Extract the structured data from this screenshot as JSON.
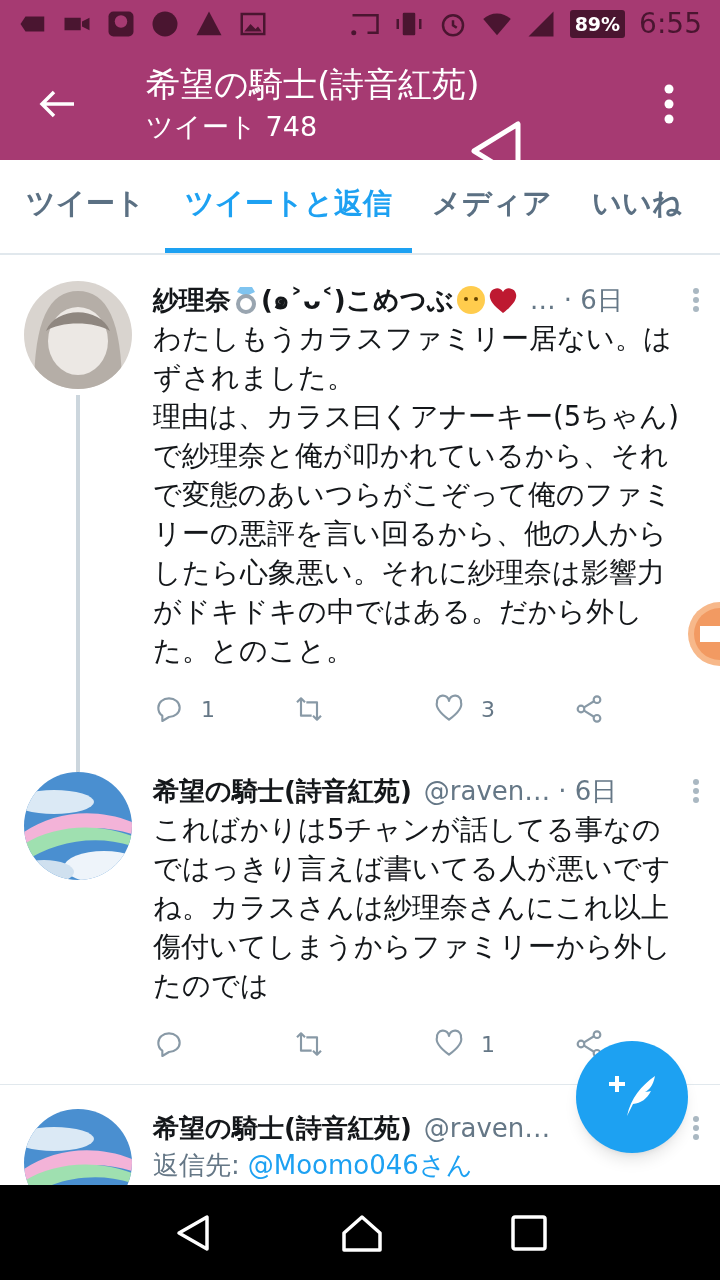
{
  "status_bar": {
    "battery": "89%",
    "time": "6:55"
  },
  "header": {
    "title": "希望の騎士(詩音紅苑)",
    "subtitle": "ツイート 748"
  },
  "tabs": [
    {
      "label": "ツイート",
      "selected": false
    },
    {
      "label": "ツイートと返信",
      "selected": true
    },
    {
      "label": "メディア",
      "selected": false
    },
    {
      "label": "いいね",
      "selected": false
    }
  ],
  "tweets": [
    {
      "name": [
        {
          "kind": "text",
          "text": "紗理奈"
        },
        {
          "kind": "ring"
        },
        {
          "kind": "text",
          "text": "(๑˃ᴗ˂)こめつぶ"
        },
        {
          "kind": "face"
        },
        {
          "kind": "heart"
        }
      ],
      "handle": "…",
      "time": "· 6日",
      "thread": true,
      "text": [
        "わたしもうカラスファミリー居ない。はずされました。",
        "理由は、カラス曰くアナーキー(5ちゃん)で紗理奈と俺が叩かれているから、それで変態のあいつらがこぞって俺のファミリーの悪評を言い回るから、他の人からしたら心象悪い。それに紗理奈は影響力がドキドキの中ではある。だから外した。とのこと。"
      ],
      "replies": "1",
      "likes": "3"
    },
    {
      "name": [
        {
          "kind": "text",
          "text": "希望の騎士(詩音紅苑)"
        }
      ],
      "handle": "@raven…",
      "time": "· 6日",
      "thread": false,
      "text": [
        "こればかりは5チャンが話してる事なのではっきり言えば書いてる人が悪いですね。カラスさんは紗理奈さんにこれ以上傷付いてしまうからファミリーから外したのでは"
      ],
      "likes": "1"
    },
    {
      "name": [
        {
          "kind": "text",
          "text": "希望の騎士(詩音紅苑)"
        }
      ],
      "handle": "@raven…",
      "thread": false,
      "reply_to": {
        "label": "返信先:",
        "user": "@Moomo046さん"
      }
    }
  ]
}
